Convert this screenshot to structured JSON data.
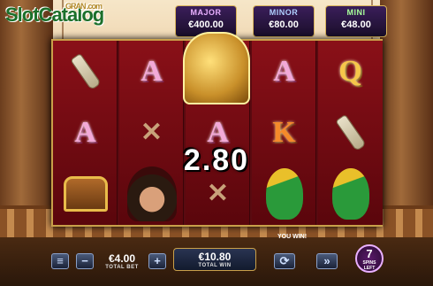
{
  "watermark": {
    "brand": "SlotCatalog",
    "sub": "GRAN .com"
  },
  "jackpots": [
    {
      "name": "MAJOR",
      "value": "€400.00"
    },
    {
      "name": "MINOR",
      "value": "€80.00"
    },
    {
      "name": "MINI",
      "value": "€48.00"
    }
  ],
  "reels": {
    "r1": [
      "bottle",
      "A",
      "treasure-chest"
    ],
    "r2": [
      "A",
      "crossed-pistols",
      "pirate"
    ],
    "r3": [
      "bell",
      "A",
      "crossed-pistols"
    ],
    "r4": [
      "A",
      "K",
      "parrot"
    ],
    "r5": [
      "Q",
      "bottle",
      "parrot"
    ]
  },
  "win": {
    "amount": "2.80",
    "you_win_label": "YOU WIN!"
  },
  "controls": {
    "bet_minus_icon": "minus-icon",
    "bet_plus_icon": "plus-icon",
    "total_bet_value": "€4.00",
    "total_bet_label": "TOTAL BET",
    "total_win_value": "€10.80",
    "total_win_label": "TOTAL WIN"
  },
  "free_spins": {
    "count": "7",
    "label": "SPINS LEFT"
  }
}
